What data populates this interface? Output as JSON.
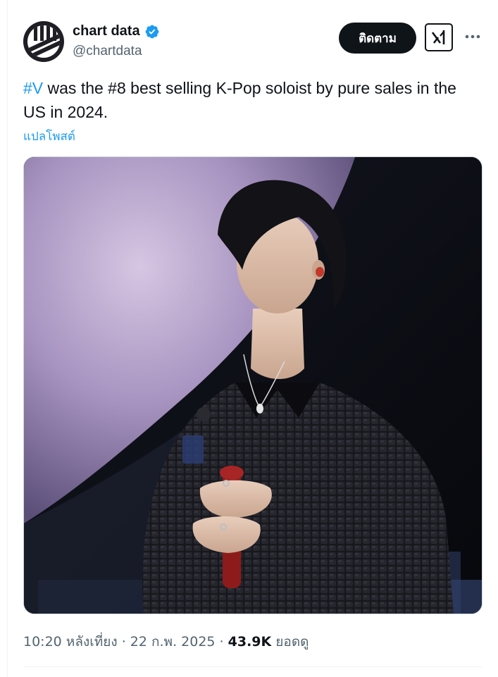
{
  "author": {
    "display_name": "chart data",
    "handle": "@chartdata",
    "verified": true,
    "avatar_icon": "chart-data-logo"
  },
  "actions": {
    "follow_label": "ติดตาม",
    "grok_icon": "grok-icon",
    "more_icon": "more-horizontal-icon"
  },
  "tweet": {
    "hashtag": "#V",
    "text_after_hashtag": " was the #8 best selling K-Pop soloist by pure sales in the US in 2024.",
    "translate_label": "แปลโพสต์"
  },
  "media": {
    "type": "photo",
    "alt": "",
    "colors": {
      "background_purple": "#b9a3cf",
      "jacket": "#15151a"
    }
  },
  "meta": {
    "time": "10:20 หลังเที่ยง",
    "separator": " · ",
    "date": "22 ก.พ. 2025",
    "views_count": "43.9K",
    "views_label": " ยอดดู"
  },
  "colors": {
    "accent": "#1d9bf0",
    "text": "#0f1419",
    "secondary": "#536471"
  }
}
